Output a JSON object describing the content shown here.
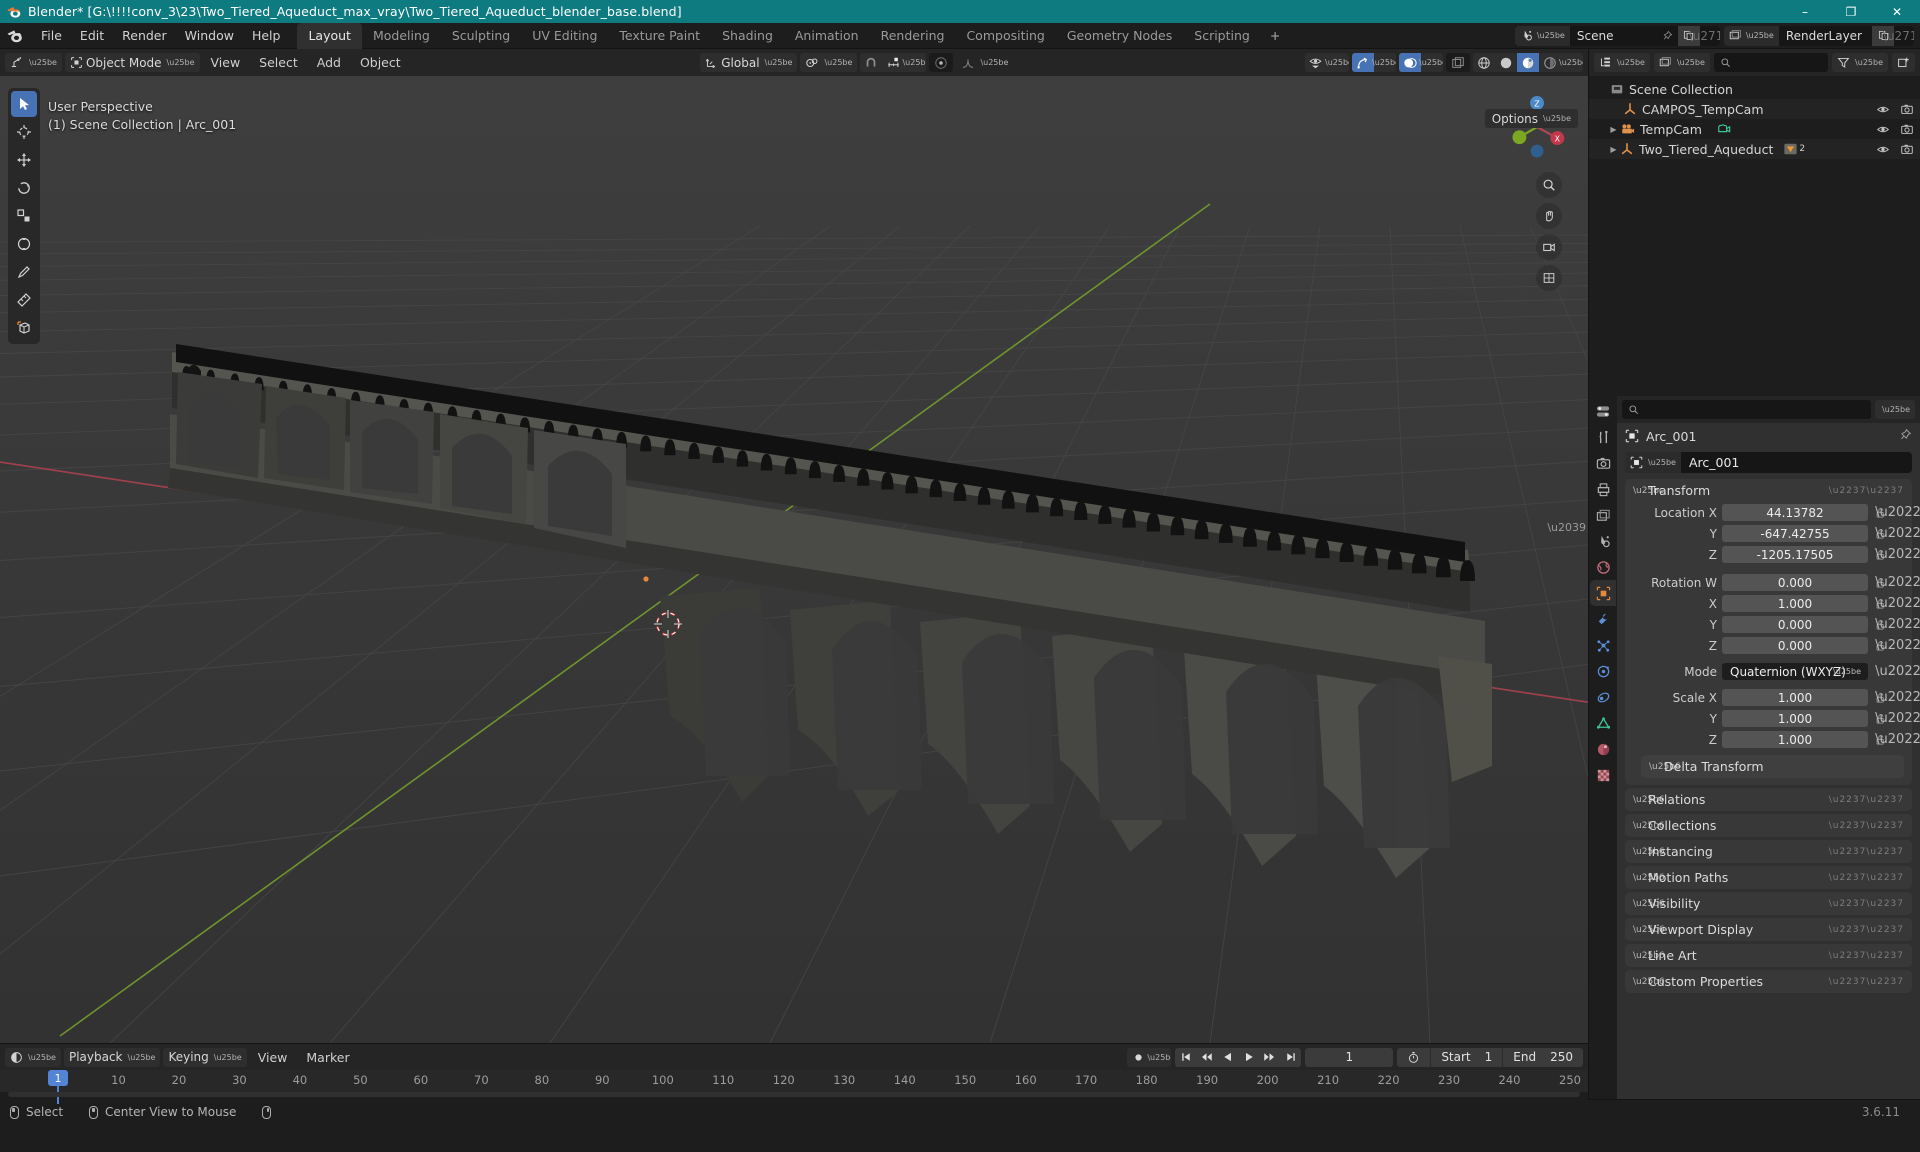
{
  "window": {
    "title": "Blender* [G:\\!!!!conv_3\\23\\Two_Tiered_Aqueduct_max_vray\\Two_Tiered_Aqueduct_blender_base.blend]",
    "minimize": "–",
    "maximize": "❐",
    "close": "✕"
  },
  "topbar": {
    "menus": [
      "File",
      "Edit",
      "Render",
      "Window",
      "Help"
    ],
    "workspaces": [
      {
        "label": "Layout",
        "active": true
      },
      {
        "label": "Modeling",
        "active": false
      },
      {
        "label": "Sculpting",
        "active": false
      },
      {
        "label": "UV Editing",
        "active": false
      },
      {
        "label": "Texture Paint",
        "active": false
      },
      {
        "label": "Shading",
        "active": false
      },
      {
        "label": "Animation",
        "active": false
      },
      {
        "label": "Rendering",
        "active": false
      },
      {
        "label": "Compositing",
        "active": false
      },
      {
        "label": "Geometry Nodes",
        "active": false
      },
      {
        "label": "Scripting",
        "active": false
      }
    ],
    "add_workspace": "+",
    "scene": {
      "name": "Scene"
    },
    "view_layer": {
      "name": "RenderLayer"
    }
  },
  "viewport": {
    "header": {
      "mode": "Object Mode",
      "menus": [
        "View",
        "Select",
        "Add",
        "Object"
      ],
      "transform_orientation": "Global",
      "options_label": "Options"
    },
    "overlay": {
      "perspective": "User Perspective",
      "scene_info": "(1) Scene Collection | Arc_001"
    },
    "gizmo_axes": {
      "x": "X",
      "y": "Y",
      "z": "Z"
    }
  },
  "timeline": {
    "menus": [
      "Playback",
      "Keying",
      "View",
      "Marker"
    ],
    "current_frame": "1",
    "start_label": "Start",
    "start_value": "1",
    "end_label": "End",
    "end_value": "250",
    "ticks": [
      "1",
      "10",
      "20",
      "30",
      "40",
      "50",
      "60",
      "70",
      "80",
      "90",
      "100",
      "110",
      "120",
      "130",
      "140",
      "150",
      "160",
      "170",
      "180",
      "190",
      "200",
      "210",
      "220",
      "230",
      "240",
      "250"
    ],
    "playhead_frame": "1"
  },
  "outliner": {
    "search_placeholder": "",
    "rows": [
      {
        "label": "Scene Collection",
        "depth": 0,
        "icon": "collection-icon",
        "disclosure": "",
        "eye": false,
        "camera": false
      },
      {
        "label": "CAMPOS_TempCam",
        "depth": 2,
        "icon": "empty-axes-icon",
        "disclosure": "",
        "eye": true,
        "camera": true
      },
      {
        "label": "TempCam",
        "depth": 1,
        "icon": "camera-data-icon",
        "disclosure": "▶",
        "eye": true,
        "camera": true,
        "badge": "camera-green"
      },
      {
        "label": "Two_Tiered_Aqueduct",
        "depth": 1,
        "icon": "empty-axes-icon",
        "disclosure": "▶",
        "eye": true,
        "camera": true,
        "badge": "mesh-orange",
        "badge_count": "2"
      }
    ]
  },
  "properties": {
    "breadcrumb": "Arc_001",
    "object_name": "Arc_001",
    "search_placeholder": "",
    "transform": {
      "title": "Transform",
      "location": {
        "label_x": "Location X",
        "label_y": "Y",
        "label_z": "Z",
        "x": "44.13782",
        "y": "-647.42755",
        "z": "-1205.17505"
      },
      "rotation": {
        "label_w": "Rotation W",
        "label_x": "X",
        "label_y": "Y",
        "label_z": "Z",
        "w": "0.000",
        "x": "1.000",
        "y": "0.000",
        "z": "0.000"
      },
      "mode_label": "Mode",
      "mode_value": "Quaternion (WXYZ)",
      "scale": {
        "label_x": "Scale X",
        "label_y": "Y",
        "label_z": "Z",
        "x": "1.000",
        "y": "1.000",
        "z": "1.000"
      },
      "delta_transform": "Delta Transform"
    },
    "panels": [
      "Relations",
      "Collections",
      "Instancing",
      "Motion Paths",
      "Visibility",
      "Viewport Display",
      "Line Art",
      "Custom Properties"
    ]
  },
  "statusbar": {
    "select": "Select",
    "center_view": "Center View to Mouse",
    "version": "3.6.11"
  },
  "colors": {
    "title_bar": "#0d7b80",
    "accent_blue": "#4772b3",
    "editor_bg": "#1d1d1d",
    "header_bg": "#252525",
    "panel_bg": "#303030",
    "viewport_bg": "#393939",
    "axis_x": "#c0384a",
    "axis_y": "#7aa822",
    "active_orange": "#e8893a"
  }
}
